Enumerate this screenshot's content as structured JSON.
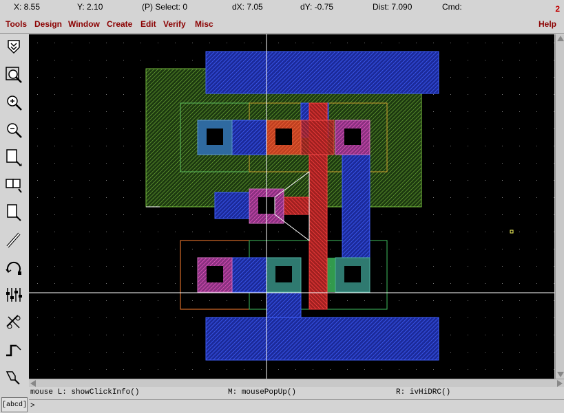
{
  "status": {
    "x": "X:  8.55",
    "y": "Y:  2.10",
    "select": "(P) Select: 0",
    "dx": "dX:  7.05",
    "dy": "dY: -0.75",
    "dist": "Dist: 7.090",
    "cmd": "Cmd:",
    "window_number": "2"
  },
  "menu": {
    "items": [
      "Tools",
      "Design",
      "Window",
      "Create",
      "Edit",
      "Verify",
      "Misc"
    ],
    "help": "Help"
  },
  "toolbar": {
    "icons": [
      "save-icon",
      "zoom-fit-icon",
      "zoom-in-icon",
      "zoom-out-icon",
      "stretch-icon",
      "copy-icon",
      "move-icon",
      "delete-icon",
      "undo-icon",
      "property-icon",
      "ruler-icon",
      "path-icon",
      "polygon-icon"
    ],
    "label_tool": "[abcd]"
  },
  "mouse": {
    "left": "mouse L: showClickInfo()",
    "middle": "M: mousePopUp()",
    "right": "R: ivHiDRC()"
  },
  "cmdline": {
    "prompt": ">"
  },
  "colors": {
    "nwell": "#7fd04f",
    "pdiff": "#d4b04a",
    "ndiff": "#3fc060",
    "poly": "#e03030",
    "metal1": "#3050ff",
    "contact": "#ff60ff",
    "select_orange": "#ff8030"
  }
}
